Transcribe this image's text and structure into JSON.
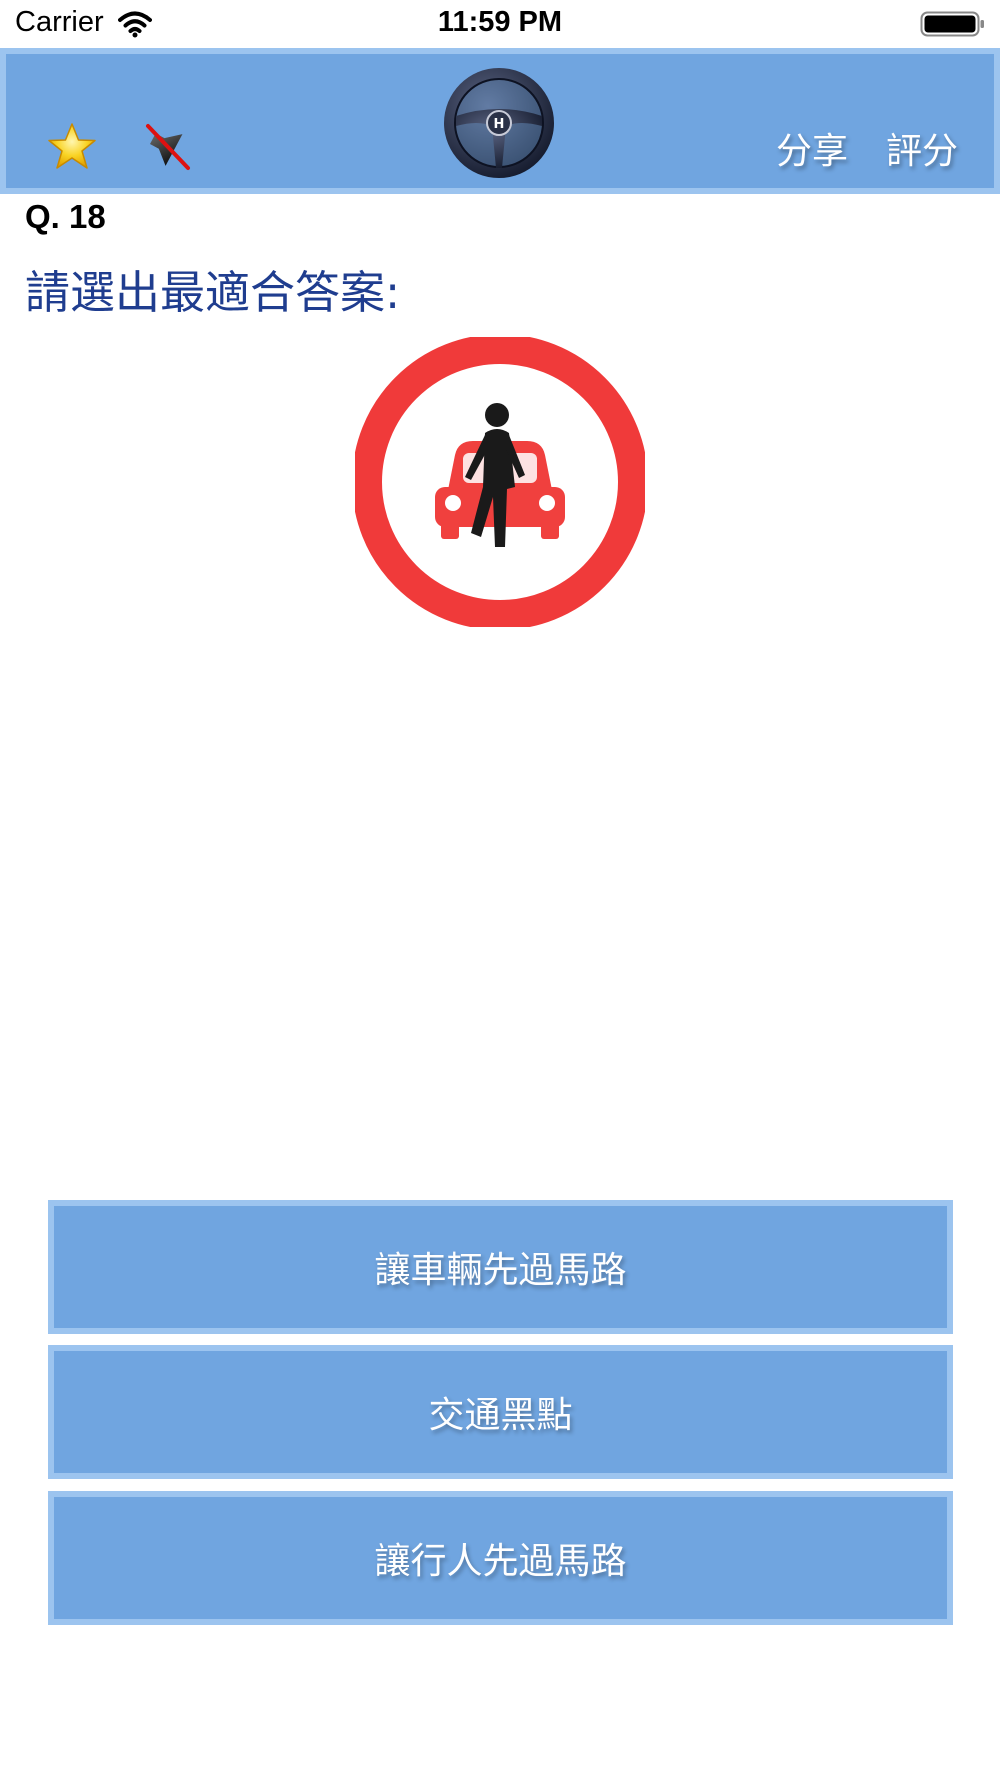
{
  "status_bar": {
    "carrier": "Carrier",
    "time": "11:59 PM",
    "icons": [
      "wifi-icon",
      "battery-icon"
    ]
  },
  "header": {
    "background_color": "#70a5e0",
    "border_color": "#9cc4ef",
    "star_icon": "star-icon",
    "mute_icon": "speaker-muted-icon",
    "logo_icon": "steering-wheel-icon",
    "share_label": "分享",
    "rate_label": "評分"
  },
  "question": {
    "number": "Q. 18",
    "prompt": "請選出最適合答案:",
    "prompt_color": "#1f3d8f",
    "image": "no-pedestrian-and-vehicle-sign-icon"
  },
  "answers": [
    {
      "label": "讓車輛先過馬路"
    },
    {
      "label": "交通黑點"
    },
    {
      "label": "讓行人先過馬路"
    }
  ]
}
